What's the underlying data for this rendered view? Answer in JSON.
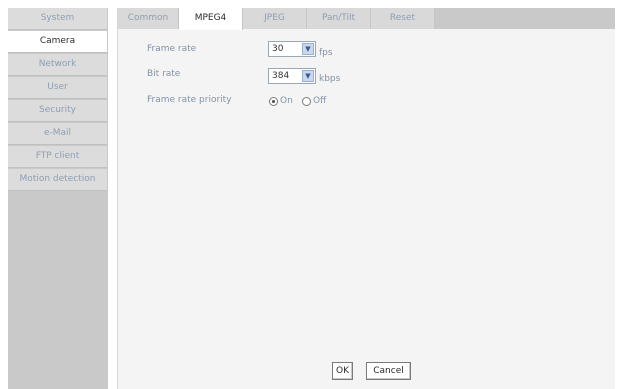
{
  "sidebar": {
    "items": [
      {
        "label": "System"
      },
      {
        "label": "Camera"
      },
      {
        "label": "Network"
      },
      {
        "label": "User"
      },
      {
        "label": "Security"
      },
      {
        "label": "e-Mail"
      },
      {
        "label": "FTP client"
      },
      {
        "label": "Motion detection"
      }
    ],
    "active": "Camera"
  },
  "tabs": [
    {
      "label": "Common"
    },
    {
      "label": "MPEG4"
    },
    {
      "label": "JPEG"
    },
    {
      "label": "Pan/Tilt"
    },
    {
      "label": "Reset"
    }
  ],
  "active_tab": "MPEG4",
  "form": {
    "frame_rate": {
      "label": "Frame rate",
      "value": "30",
      "unit": "fps"
    },
    "bit_rate": {
      "label": "Bit rate",
      "value": "384",
      "unit": "kbps"
    },
    "frame_rate_priority": {
      "label": "Frame rate priority",
      "options": [
        "On",
        "Off"
      ],
      "selected": "On"
    }
  },
  "buttons": {
    "ok": "OK",
    "cancel": "Cancel"
  },
  "icons": {
    "dropdown": "chevron-down-icon"
  },
  "colors": {
    "sidebar_bg": "#c9c9c9",
    "active_bg": "#ffffff",
    "inactive_text": "#8f9fb3",
    "panel_bg": "#f4f4f4"
  }
}
